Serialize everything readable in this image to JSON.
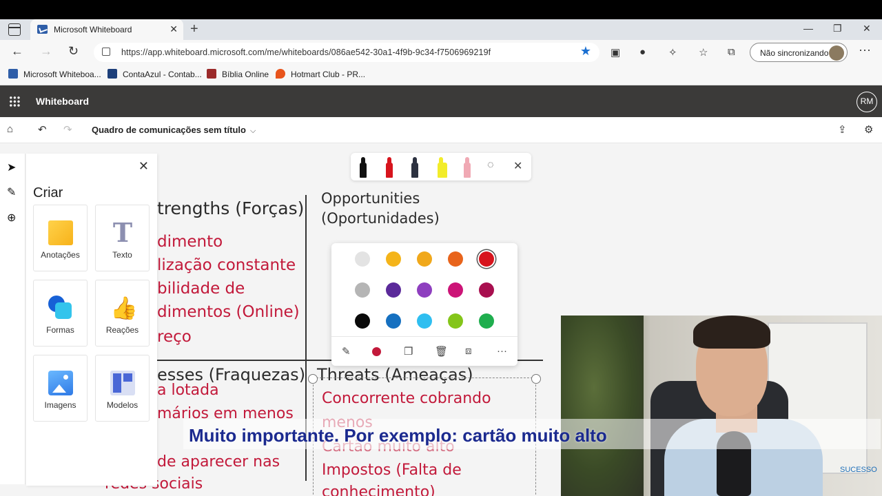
{
  "browser": {
    "tab_title": "Microsoft Whiteboard",
    "url": "https://app.whiteboard.microsoft.com/me/whiteboards/086ae542-30a1-4f9b-9c34-f7506969219f",
    "sync_label": "Não sincronizando",
    "bookmarks": [
      {
        "label": "Microsoft Whiteboa...",
        "color": "#2f5ea8"
      },
      {
        "label": "ContaAzul - Contab...",
        "color": "#1d3f7a"
      },
      {
        "label": "Bíblia Online",
        "color": "#9b2a2a"
      },
      {
        "label": "Hotmart Club - PR...",
        "color": "#e8541c"
      }
    ]
  },
  "app": {
    "title": "Whiteboard",
    "user_initials": "RM",
    "board_title": "Quadro de comunicações sem título"
  },
  "create_panel": {
    "heading": "Criar",
    "tiles": [
      {
        "label": "Anotações",
        "icon": "sticky-note-icon"
      },
      {
        "label": "Texto",
        "icon": "text-icon"
      },
      {
        "label": "Formas",
        "icon": "shapes-icon"
      },
      {
        "label": "Reações",
        "icon": "thumbs-up-icon"
      },
      {
        "label": "Imagens",
        "icon": "image-icon"
      },
      {
        "label": "Modelos",
        "icon": "templates-icon"
      }
    ]
  },
  "colors": {
    "row1": [
      "#e3e3e3",
      "#f4b41a",
      "#f0a81b",
      "#e8641c",
      "#d7141d"
    ],
    "row2": [
      "#b5b5b5",
      "#5b2a9a",
      "#8e3fbf",
      "#cc1477",
      "#a80f4f"
    ],
    "row3": [
      "#0a0a0a",
      "#1670c0",
      "#2fbef0",
      "#84c51a",
      "#1fae4e"
    ],
    "selected": "#d7141d"
  },
  "board": {
    "strengths_title": "trengths (Forças)",
    "opportunities_title_1": "Opportunities",
    "opportunities_title_2": "(Oportunidades)",
    "strengths_items": [
      "dimento",
      "lização constante",
      "bilidade de",
      "dimentos (Online)",
      "reço"
    ],
    "weaknesses_title": "esses (Fraquezas)",
    "threats_title": "Threats (Ameaças)",
    "weaknesses_items": [
      "a lotada",
      "mários em menos",
      "de aparecer nas",
      "redes sociais"
    ],
    "threats_items": [
      "Concorrente cobrando",
      "menos",
      "Cartão muito alto",
      "Impostos (Falta de",
      "conhecimento)"
    ]
  },
  "subtitle": "Muito importante. Por exemplo: cartão muito alto",
  "webcam_logo": "SUCESSO"
}
